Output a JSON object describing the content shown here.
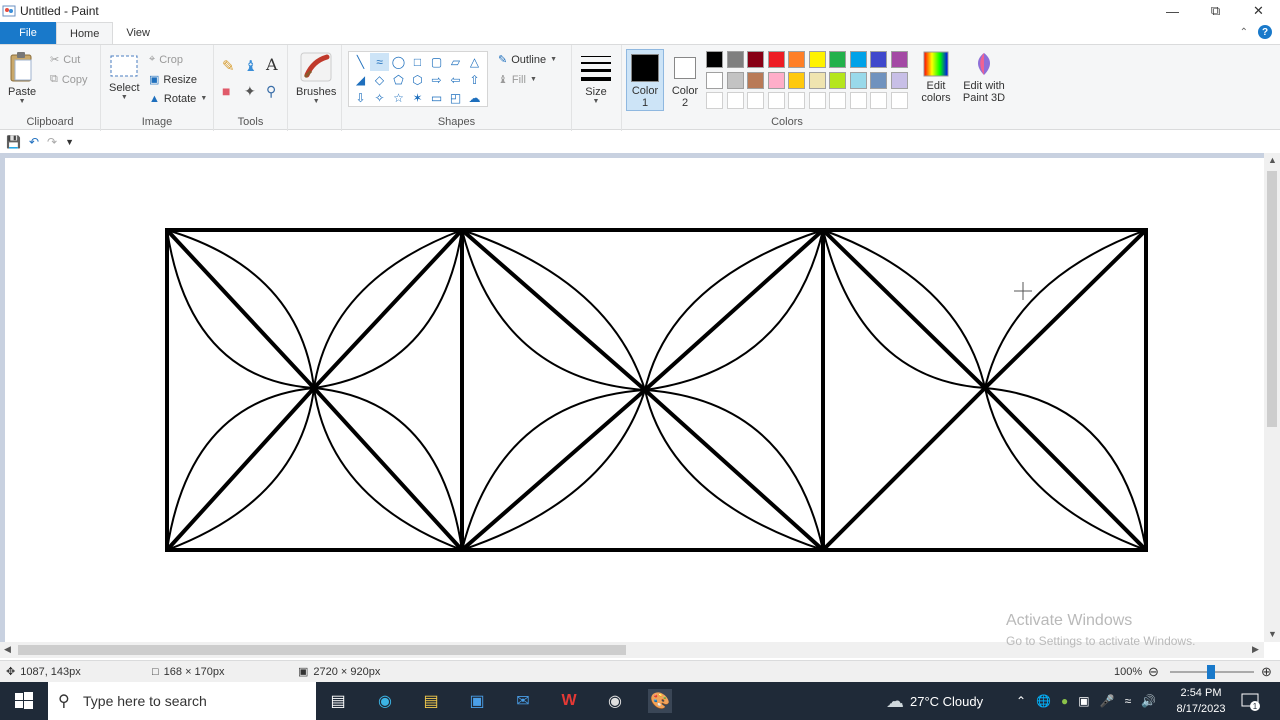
{
  "window": {
    "title": "Untitled - Paint"
  },
  "tabs": {
    "file": "File",
    "home": "Home",
    "view": "View"
  },
  "clipboard": {
    "paste": "Paste",
    "cut": "Cut",
    "copy": "Copy",
    "label": "Clipboard"
  },
  "image": {
    "select": "Select",
    "crop": "Crop",
    "resize": "Resize",
    "rotate": "Rotate",
    "label": "Image"
  },
  "tools": {
    "label": "Tools"
  },
  "brushes": {
    "label": "Brushes"
  },
  "shapes": {
    "outline": "Outline",
    "fill": "Fill",
    "label": "Shapes"
  },
  "size": {
    "label": "Size"
  },
  "colors": {
    "color1": "Color 1",
    "color2": "Color 2",
    "edit_colors": "Edit colors",
    "edit_paint3d": "Edit with Paint 3D",
    "label": "Colors",
    "color1_value": "#000000",
    "color2_value": "#ffffff",
    "palette_row1": [
      "#000000",
      "#7f7f7f",
      "#880015",
      "#ed1c24",
      "#ff7f27",
      "#fff200",
      "#22b14c",
      "#00a2e8",
      "#3f48cc",
      "#a349a4"
    ],
    "palette_row2": [
      "#ffffff",
      "#c3c3c3",
      "#b97a57",
      "#ffaec9",
      "#ffc90e",
      "#efe4b0",
      "#b5e61d",
      "#99d9ea",
      "#7092be",
      "#c8bfe7"
    ],
    "palette_row3": [
      "#ffffff",
      "#ffffff",
      "#ffffff",
      "#ffffff",
      "#ffffff",
      "#ffffff",
      "#ffffff",
      "#ffffff",
      "#ffffff",
      "#ffffff"
    ]
  },
  "watermark": {
    "line1": "Activate Windows",
    "line2": "Go to Settings to activate Windows."
  },
  "status": {
    "cursor": "1087, 143px",
    "selection": "168 × 170px",
    "image_size": "2720 × 920px",
    "zoom": "100%"
  },
  "taskbar": {
    "search_placeholder": "Type here to search",
    "weather": "27°C  Cloudy",
    "time": "2:54 PM",
    "date": "8/17/2023"
  }
}
